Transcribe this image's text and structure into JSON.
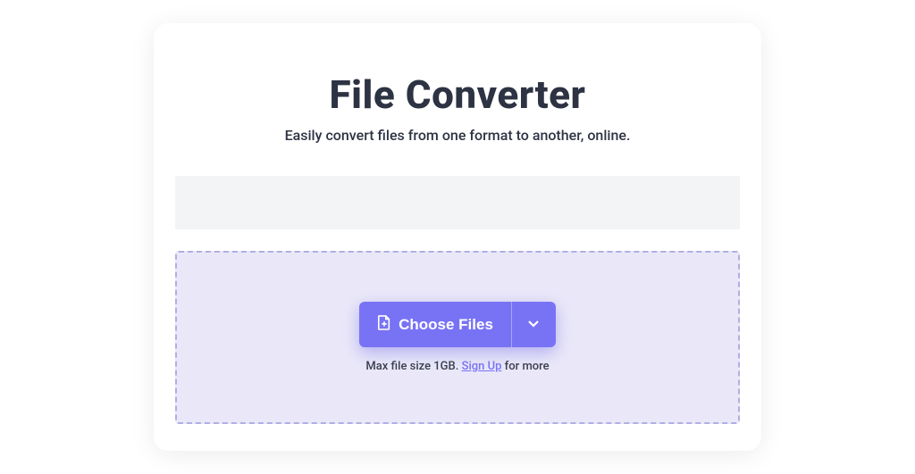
{
  "header": {
    "title": "File Converter",
    "subtitle": "Easily convert files from one format to another, online."
  },
  "dropzone": {
    "button_label": "Choose Files",
    "caption_before": "Max file size 1GB. ",
    "signup_link": "Sign Up",
    "caption_after": " for more"
  },
  "colors": {
    "accent": "#7873f5",
    "dropzone_bg": "#eae8f8",
    "dashed_border": "#b0aee2",
    "text_dark": "#2d3343"
  }
}
